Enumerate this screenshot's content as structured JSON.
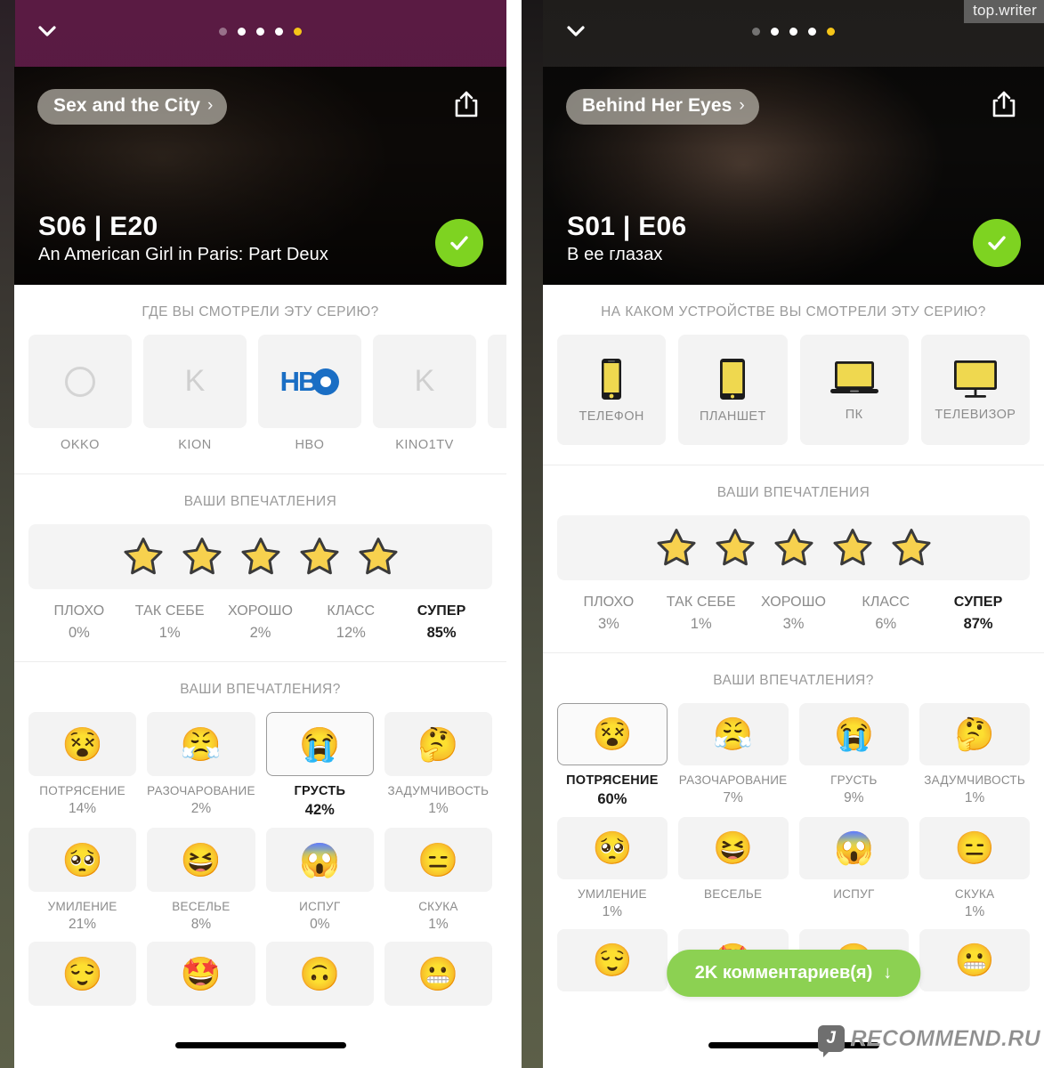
{
  "watermarks": {
    "top_right": "top.writer",
    "bottom_right": "RECOMMEND.RU"
  },
  "panels": [
    {
      "id": "left",
      "pager": {
        "total": 5,
        "dim_index": 0,
        "active_index": 4
      },
      "chevron_icon": "chevron-down-icon",
      "share_icon": "share-icon",
      "hero": {
        "show_title": "Sex and the City",
        "show_chevron": "›",
        "episode_number": "S06 | E20",
        "episode_title": "An American Girl in Paris: Part Deux",
        "watched_icon": "check-icon",
        "watched_color": "#7ed321"
      },
      "services_section": {
        "title": "ГДЕ ВЫ СМОТРЕЛИ ЭТУ СЕРИЮ?",
        "items": [
          {
            "name": "OKKO",
            "glyph": "O",
            "kind": "ring",
            "selected": false
          },
          {
            "name": "KION",
            "glyph": "K",
            "kind": "letter",
            "selected": false
          },
          {
            "name": "HBO",
            "glyph": "HBO",
            "kind": "hbo",
            "selected": false
          },
          {
            "name": "KINO1TV",
            "glyph": "K",
            "kind": "letter",
            "selected": false
          },
          {
            "name": "",
            "glyph": "",
            "kind": "partial",
            "selected": false
          }
        ]
      },
      "rating_section": {
        "title": "ВАШИ ВПЕЧАТЛЕНИЯ",
        "stars_filled": 5,
        "labels": [
          "ПЛОХО",
          "ТАК СЕБЕ",
          "ХОРОШО",
          "КЛАСС",
          "СУПЕР"
        ],
        "values": [
          "0%",
          "1%",
          "2%",
          "12%",
          "85%"
        ],
        "highlight_index": 4
      },
      "emotions_section": {
        "title": "ВАШИ ВПЕЧАТЛЕНИЯ?",
        "items": [
          {
            "emoji": "😵",
            "name": "ПОТРЯСЕНИЕ",
            "value": "14%",
            "selected": false
          },
          {
            "emoji": "😤",
            "name": "РАЗОЧАРОВАНИЕ",
            "value": "2%",
            "selected": false
          },
          {
            "emoji": "😭",
            "name": "ГРУСТЬ",
            "value": "42%",
            "selected": true
          },
          {
            "emoji": "🤔",
            "name": "ЗАДУМЧИВОСТЬ",
            "value": "1%",
            "selected": false
          },
          {
            "emoji": "🥺",
            "name": "УМИЛЕНИЕ",
            "value": "21%",
            "selected": false
          },
          {
            "emoji": "😆",
            "name": "ВЕСЕЛЬЕ",
            "value": "8%",
            "selected": false
          },
          {
            "emoji": "😱",
            "name": "ИСПУГ",
            "value": "0%",
            "selected": false
          },
          {
            "emoji": "😑",
            "name": "СКУКА",
            "value": "1%",
            "selected": false
          },
          {
            "emoji": "😌",
            "name": "",
            "value": "",
            "selected": false
          },
          {
            "emoji": "🤩",
            "name": "",
            "value": "",
            "selected": false
          },
          {
            "emoji": "🙃",
            "name": "",
            "value": "",
            "selected": false
          },
          {
            "emoji": "😬",
            "name": "",
            "value": "",
            "selected": false
          }
        ]
      },
      "comments_button": null
    },
    {
      "id": "right",
      "pager": {
        "total": 5,
        "dim_index": 0,
        "active_index": 4
      },
      "chevron_icon": "chevron-down-icon",
      "share_icon": "share-icon",
      "hero": {
        "show_title": "Behind Her Eyes",
        "show_chevron": "›",
        "episode_number": "S01 | E06",
        "episode_title": "В ее глазах",
        "watched_icon": "check-icon",
        "watched_color": "#7ed321"
      },
      "devices_section": {
        "title": "НА КАКОМ УСТРОЙСТВЕ ВЫ СМОТРЕЛИ ЭТУ СЕРИЮ?",
        "items": [
          {
            "name": "ТЕЛЕФОН",
            "icon": "phone-icon",
            "selected": false
          },
          {
            "name": "ПЛАНШЕТ",
            "icon": "tablet-icon",
            "selected": false
          },
          {
            "name": "ПК",
            "icon": "laptop-icon",
            "selected": false
          },
          {
            "name": "ТЕЛЕВИЗОР",
            "icon": "tv-icon",
            "selected": false
          }
        ]
      },
      "rating_section": {
        "title": "ВАШИ ВПЕЧАТЛЕНИЯ",
        "stars_filled": 5,
        "labels": [
          "ПЛОХО",
          "ТАК СЕБЕ",
          "ХОРОШО",
          "КЛАСС",
          "СУПЕР"
        ],
        "values": [
          "3%",
          "1%",
          "3%",
          "6%",
          "87%"
        ],
        "highlight_index": 4
      },
      "emotions_section": {
        "title": "ВАШИ ВПЕЧАТЛЕНИЯ?",
        "items": [
          {
            "emoji": "😵",
            "name": "ПОТРЯСЕНИЕ",
            "value": "60%",
            "selected": true
          },
          {
            "emoji": "😤",
            "name": "РАЗОЧАРОВАНИЕ",
            "value": "7%",
            "selected": false
          },
          {
            "emoji": "😭",
            "name": "ГРУСТЬ",
            "value": "9%",
            "selected": false
          },
          {
            "emoji": "🤔",
            "name": "ЗАДУМЧИВОСТЬ",
            "value": "1%",
            "selected": false
          },
          {
            "emoji": "🥺",
            "name": "УМИЛЕНИЕ",
            "value": "1%",
            "selected": false
          },
          {
            "emoji": "😆",
            "name": "ВЕСЕЛЬЕ",
            "value": "",
            "selected": false
          },
          {
            "emoji": "😱",
            "name": "ИСПУГ",
            "value": "",
            "selected": false
          },
          {
            "emoji": "😑",
            "name": "СКУКА",
            "value": "1%",
            "selected": false
          },
          {
            "emoji": "😌",
            "name": "",
            "value": "",
            "selected": false
          },
          {
            "emoji": "🤩",
            "name": "",
            "value": "",
            "selected": false
          },
          {
            "emoji": "🙃",
            "name": "",
            "value": "",
            "selected": false
          },
          {
            "emoji": "😬",
            "name": "",
            "value": "",
            "selected": false
          }
        ]
      },
      "comments_button": {
        "label": "2K комментариев(я)",
        "arrow": "↓",
        "color": "#8cd152"
      }
    }
  ]
}
